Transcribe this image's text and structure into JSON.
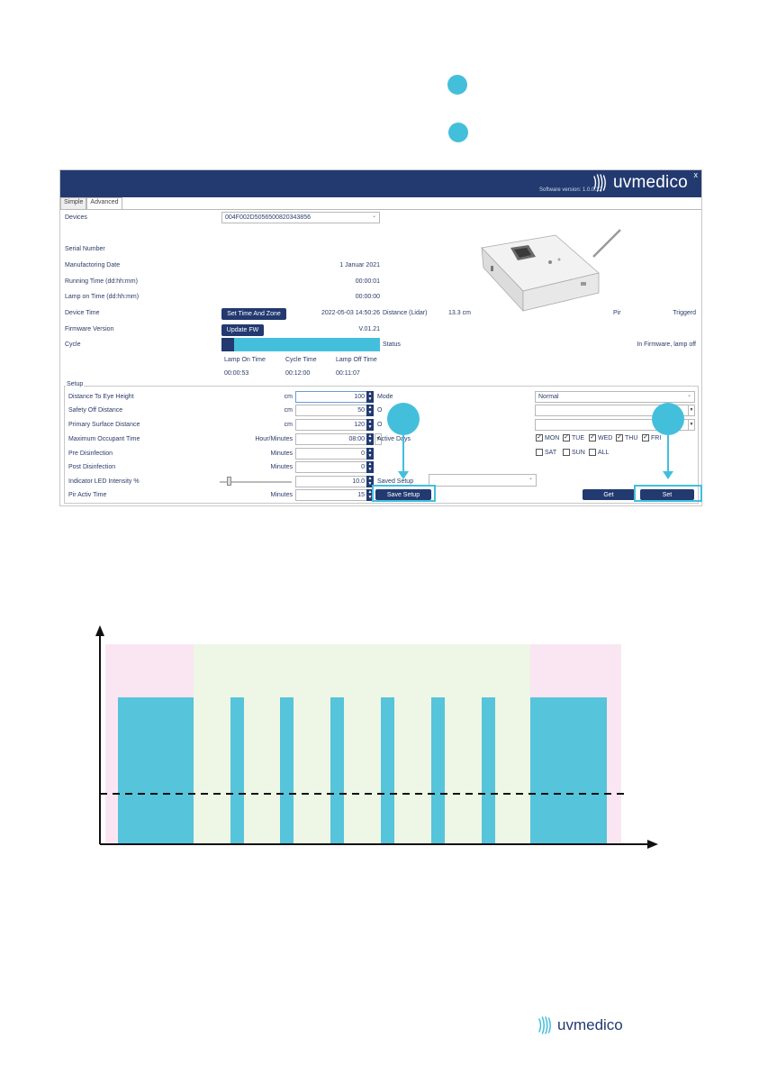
{
  "window": {
    "close_label": "x",
    "brand": "uvmedico",
    "software_version": "Software version: 1.0.0.12",
    "tabs": [
      "Simple",
      "Advanced"
    ]
  },
  "device": {
    "devices_label": "Devices",
    "devices_value": "004F002D5056500820343856",
    "serial_label": "Serial Number",
    "mfg_date_label": "Manufactoring Date",
    "mfg_date_value": "1 Januar 2021",
    "running_label": "Running Time (dd:hh:mm)",
    "running_value": "00:00:01",
    "lamp_on_label": "Lamp on Time (dd:hh:mm)",
    "lamp_on_value": "00:00:00",
    "device_time_label": "Device Time",
    "set_time_button": "Set Time And Zone",
    "device_time_value": "2022-05-03 14:50:26",
    "distance_label": "Distance (Lidar)",
    "distance_value": "13.3 cm",
    "pir_label": "Pir",
    "pir_value": "Triggerd",
    "firmware_label": "Firmware Version",
    "update_button": "Update FW",
    "firmware_value": "V.01.21",
    "cycle_label": "Cycle",
    "cycle_progress": 0.08,
    "status_label": "Status",
    "status_value": "In Firmware, lamp off",
    "lamp_on_time_h": "Lamp On Time",
    "cycle_time_h": "Cycle Time",
    "lamp_off_time_h": "Lamp Off Time",
    "lamp_on_time_v": "00:00:53",
    "cycle_time_v": "00:12:00",
    "lamp_off_time_v": "00:11:07"
  },
  "setup": {
    "title": "Setup",
    "rows": [
      {
        "label": "Distance To Eye Height",
        "unit": "cm",
        "value": "100"
      },
      {
        "label": "Safety Off Distance",
        "unit": "cm",
        "value": "50"
      },
      {
        "label": "Primary Surface Distance",
        "unit": "cm",
        "value": "120"
      },
      {
        "label": "Maximum Occupant Time",
        "unit": "Hour/Minutes",
        "value": "08:00"
      },
      {
        "label": "Pre Disinfection",
        "unit": "Minutes",
        "value": "0"
      },
      {
        "label": "Post Disinfection",
        "unit": "Minutes",
        "value": "0"
      },
      {
        "label": "Indicator LED Intensity %",
        "unit": "",
        "value": "10.0"
      },
      {
        "label": "Pir Activ Time",
        "unit": "Minutes",
        "value": "15"
      }
    ],
    "led_intensity": 0.1,
    "mode_label": "Mode",
    "mode_value": "Normal",
    "row2_label": "O",
    "row3_label": "O",
    "active_days_label": "Active Days",
    "days": [
      {
        "name": "MON",
        "checked": true
      },
      {
        "name": "TUE",
        "checked": true
      },
      {
        "name": "WED",
        "checked": true
      },
      {
        "name": "THU",
        "checked": true
      },
      {
        "name": "FRI",
        "checked": true
      },
      {
        "name": "SAT",
        "checked": false
      },
      {
        "name": "SUN",
        "checked": false
      },
      {
        "name": "ALL",
        "checked": false
      }
    ],
    "saved_setup_label": "Saved Setup",
    "save_setup_button": "Save Setup",
    "get_button": "Get",
    "set_button": "Set"
  },
  "colors": {
    "navy": "#223a70",
    "accent": "#43bfdc",
    "pink_zone": "#fae6f2",
    "green_zone": "#eef6e6"
  },
  "timeline": {
    "zones": [
      "pink",
      "green",
      "pink"
    ],
    "threshold_line": "dashed",
    "bars": [
      "wide",
      "narrow",
      "narrow",
      "narrow",
      "narrow",
      "narrow",
      "narrow",
      "wide"
    ]
  },
  "footer": {
    "brand": "uvmedico"
  }
}
